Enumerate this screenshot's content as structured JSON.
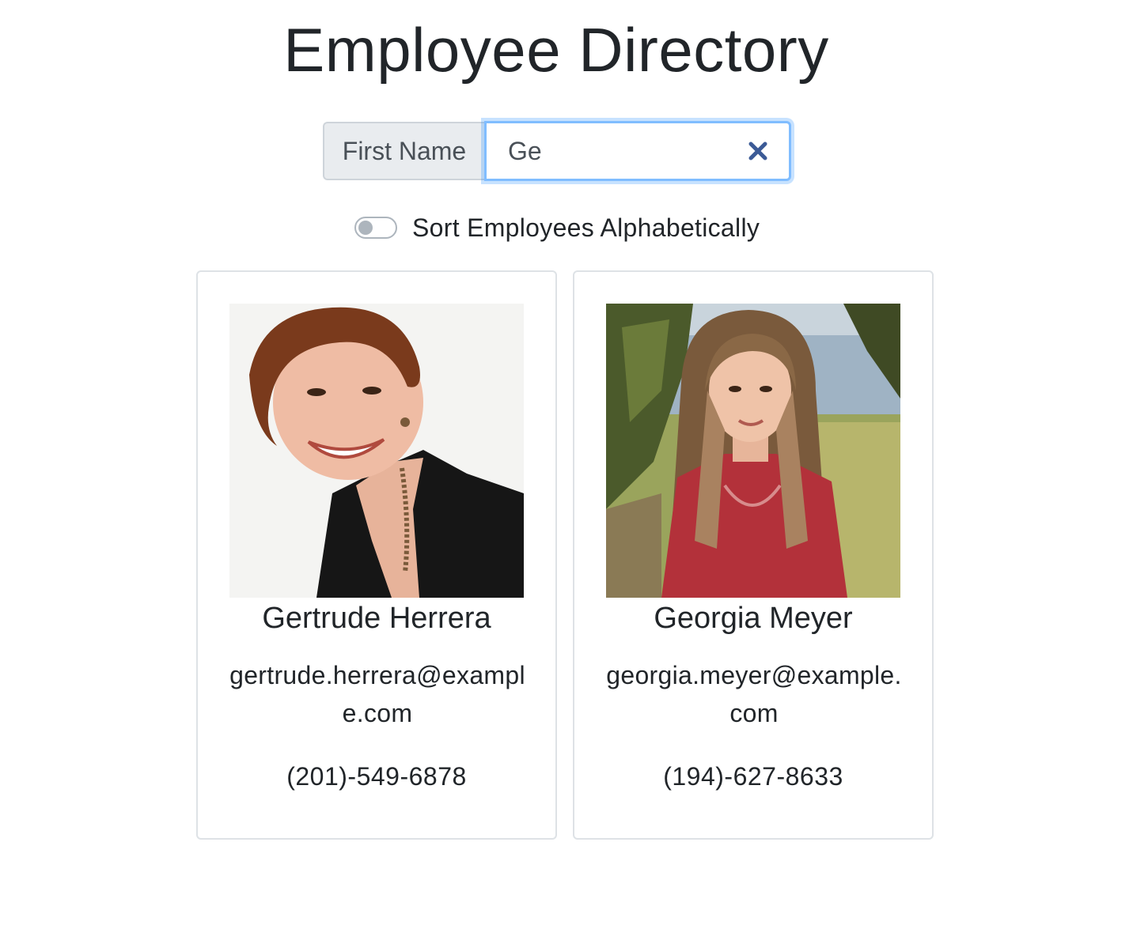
{
  "page": {
    "title": "Employee Directory"
  },
  "search": {
    "label": "First Name",
    "value": "Ge",
    "clear_icon": "close-icon"
  },
  "sort_toggle": {
    "label": "Sort Employees Alphabetically",
    "checked": false
  },
  "employees": [
    {
      "name": "Gertrude Herrera",
      "email": "gertrude.herrera@example.com",
      "phone": "(201)-549-6878",
      "photo": "portrait-woman-short-red-hair"
    },
    {
      "name": "Georgia Meyer",
      "email": "georgia.meyer@example.com",
      "phone": "(194)-627-8633",
      "photo": "portrait-woman-long-hair-outdoors"
    }
  ],
  "colors": {
    "focus_border": "#80bdff",
    "clear_icon": "#3b5a96",
    "prepend_bg": "#e9ecef",
    "card_border": "#dee2e6",
    "text": "#212529"
  }
}
